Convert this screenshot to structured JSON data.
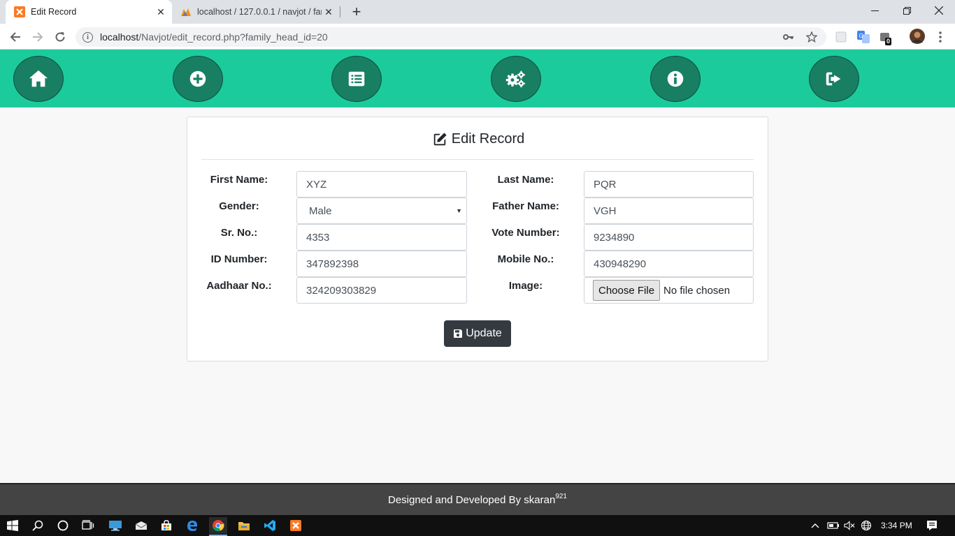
{
  "browser": {
    "tabs": [
      {
        "title": "Edit Record",
        "active": true,
        "icon": "xampp-icon"
      },
      {
        "title": "localhost / 127.0.0.1 / navjot / far",
        "active": false,
        "icon": "phpmyadmin-icon"
      }
    ],
    "url_host": "localhost",
    "url_path": "/Navjot/edit_record.php?family_head_id=20",
    "extension_badge": "0"
  },
  "nav": {
    "items": [
      {
        "name": "home",
        "icon": "home-icon"
      },
      {
        "name": "add",
        "icon": "plus-circle-icon"
      },
      {
        "name": "list",
        "icon": "list-alt-icon"
      },
      {
        "name": "settings",
        "icon": "cogs-icon"
      },
      {
        "name": "info",
        "icon": "info-circle-icon"
      },
      {
        "name": "logout",
        "icon": "sign-out-icon"
      }
    ],
    "accent": "#1ccb9b",
    "circle_color": "#187f63"
  },
  "form": {
    "title": "Edit Record",
    "fields": {
      "first_name": {
        "label": "First Name:",
        "value": "XYZ"
      },
      "last_name": {
        "label": "Last Name:",
        "value": "PQR"
      },
      "gender": {
        "label": "Gender:",
        "value": "Male"
      },
      "father_name": {
        "label": "Father Name:",
        "value": "VGH"
      },
      "sr_no": {
        "label": "Sr. No.:",
        "value": "4353"
      },
      "vote_number": {
        "label": "Vote Number:",
        "value": "9234890"
      },
      "id_number": {
        "label": "ID Number:",
        "value": "347892398"
      },
      "mobile_no": {
        "label": "Mobile No.:",
        "value": "430948290"
      },
      "aadhaar_no": {
        "label": "Aadhaar No.:",
        "value": "324209303829"
      },
      "image": {
        "label": "Image:",
        "button": "Choose File",
        "status": "No file chosen"
      }
    },
    "submit_label": "Update"
  },
  "footer": {
    "text": "Designed and Developed By skaran",
    "sup": "921"
  },
  "taskbar": {
    "time": "3:34 PM"
  }
}
